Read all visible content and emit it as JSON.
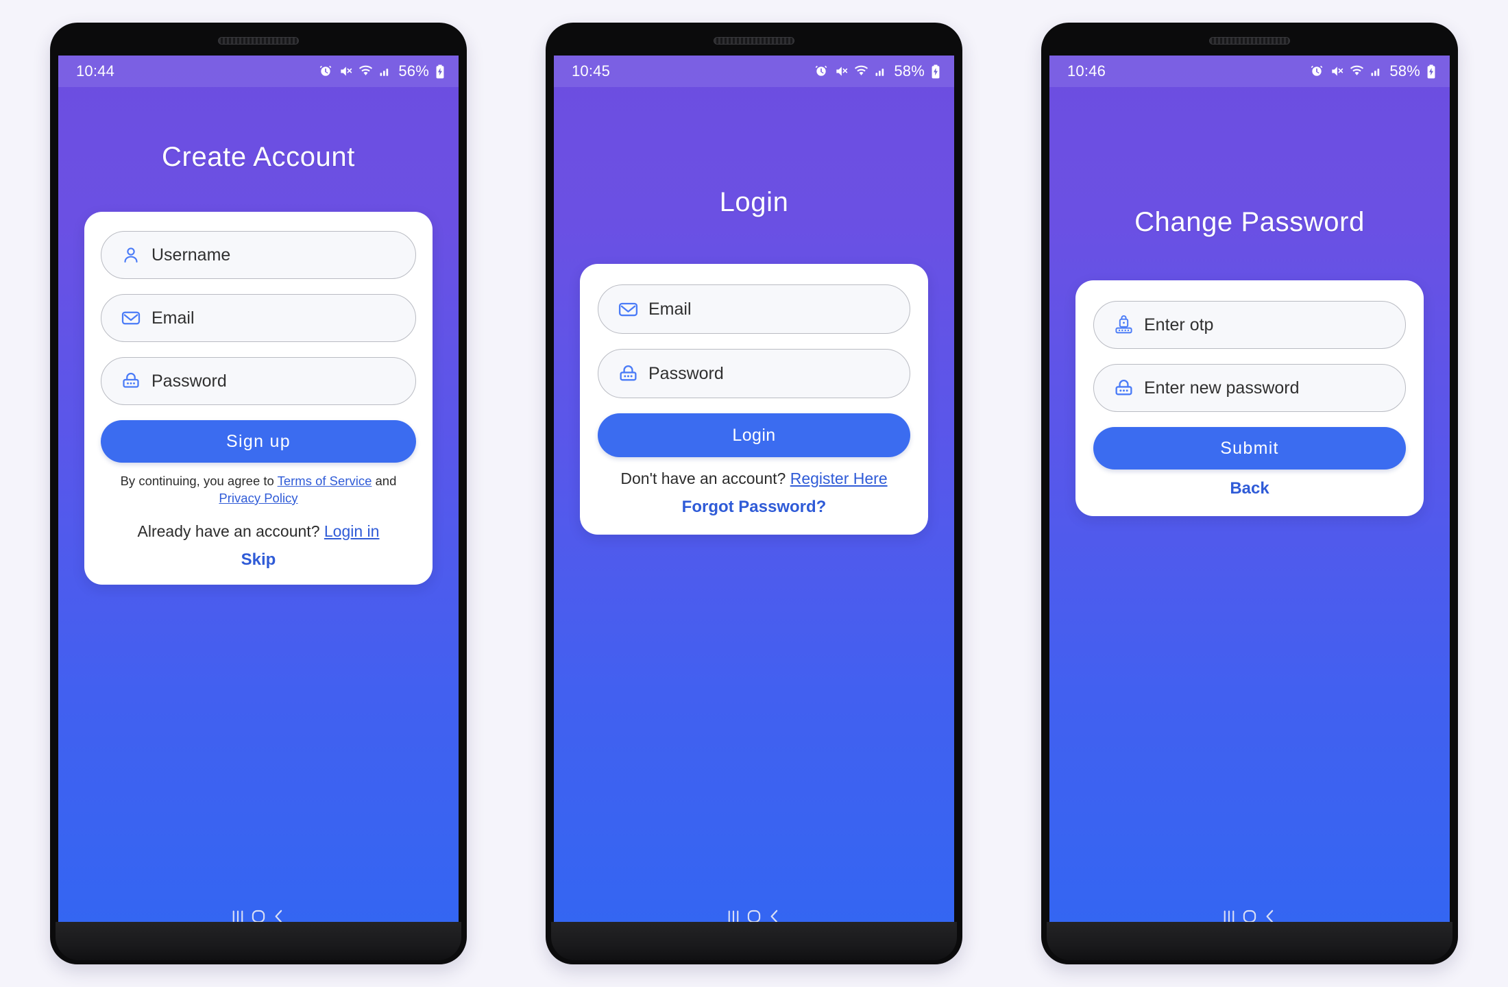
{
  "page": {
    "background_color": "#f5f4fb",
    "gradient_top": "#6d4ee0",
    "gradient_bottom": "#3366f2",
    "accent_blue": "#3b6cf0",
    "link_blue": "#2f5bd7"
  },
  "phones": [
    {
      "id": "create-account",
      "status": {
        "time": "10:44",
        "battery": "56%",
        "icons": [
          "alarm-icon",
          "mute-icon",
          "wifi-icon",
          "signal-icon",
          "battery-charging-icon"
        ]
      },
      "title": "Create Account",
      "fields": [
        {
          "name": "username",
          "icon": "user-icon",
          "placeholder": "Username"
        },
        {
          "name": "email",
          "icon": "envelope-icon",
          "placeholder": "Email"
        },
        {
          "name": "password",
          "icon": "lock-icon",
          "placeholder": "Password"
        }
      ],
      "primary_button": "Sign up",
      "legal": {
        "prefix": "By continuing, you agree to ",
        "link1": "Terms of Service",
        "middle": " and ",
        "link2": "Privacy Policy"
      },
      "have_account": {
        "text": "Already have an account? ",
        "link": "Login in"
      },
      "skip_link": "Skip",
      "nav": [
        "recents-icon",
        "home-icon",
        "back-icon"
      ]
    },
    {
      "id": "login",
      "status": {
        "time": "10:45",
        "battery": "58%",
        "icons": [
          "alarm-icon",
          "mute-icon",
          "wifi-icon",
          "signal-icon",
          "battery-charging-icon"
        ]
      },
      "title": "Login",
      "fields": [
        {
          "name": "email",
          "icon": "envelope-icon",
          "placeholder": "Email"
        },
        {
          "name": "password",
          "icon": "lock-icon",
          "placeholder": "Password"
        }
      ],
      "primary_button": "Login",
      "register": {
        "text": "Don't have an account? ",
        "link": "Register Here"
      },
      "forgot_link": "Forgot Password?",
      "nav": [
        "recents-icon",
        "home-icon",
        "back-icon"
      ]
    },
    {
      "id": "change-password",
      "status": {
        "time": "10:46",
        "battery": "58%",
        "icons": [
          "alarm-icon",
          "mute-icon",
          "wifi-icon",
          "signal-icon",
          "battery-charging-icon"
        ]
      },
      "title": "Change Password",
      "fields": [
        {
          "name": "otp",
          "icon": "otp-lock-icon",
          "placeholder": "Enter otp"
        },
        {
          "name": "new-password",
          "icon": "lock-icon",
          "placeholder": "Enter new password"
        }
      ],
      "primary_button": "Submit",
      "back_link": "Back",
      "nav": [
        "recents-icon",
        "home-icon",
        "back-icon"
      ]
    }
  ]
}
